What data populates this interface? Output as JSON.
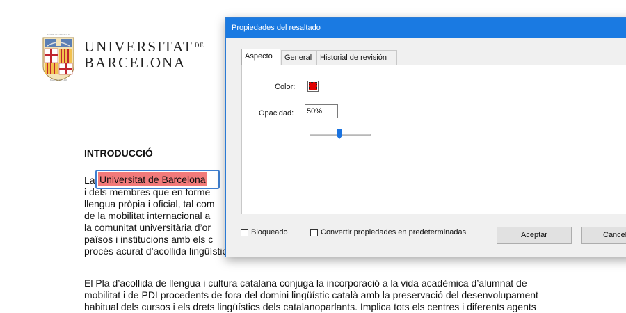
{
  "document": {
    "logo": {
      "line1": "UNIVERSITAT",
      "line1_suffix": "DE",
      "line2": "BARCELONA"
    },
    "heading": "INTRODUCCIÓ",
    "paragraph1": {
      "lines": [
        "La",
        "i dels membres que en forme",
        "llengua pròpia i oficial, tal com",
        "de la mobilitat internacional a",
        "la comunitat universitària d’or",
        "països i institucions amb els c",
        "procés acurat d’acollida lingüística i cultural, destinat a l’alumnat de grau i de postgrau, i també al PDI."
      ],
      "highlighted_text": "Universitat de Barcelona",
      "highlight_color": "#f27a7a"
    },
    "paragraph2": {
      "lines": [
        "El Pla d’acollida de llengua i cultura catalana conjuga la incorporació a la vida acadèmica d’alumnat de",
        "mobilitat i de PDI procedents de fora del domini lingüístic català amb la preservació del desenvolupament",
        "habitual dels cursos i els drets lingüístics dels catalanoparlants. Implica tots els centres i diferents agents"
      ]
    }
  },
  "dialog": {
    "title": "Propiedades del resaltado",
    "tabs": [
      {
        "label": "Aspecto",
        "active": true
      },
      {
        "label": "General",
        "active": false
      },
      {
        "label": "Historial de revisión",
        "active": false
      }
    ],
    "color_label": "Color:",
    "color_value": "#e00000",
    "opacity_label": "Opacidad:",
    "opacity_value": "50%",
    "opacity_slider_fraction": 0.5,
    "locked_label": "Bloqueado",
    "locked_checked": false,
    "defaults_label": "Convertir propiedades en predeterminadas",
    "defaults_checked": false,
    "ok_button": "Aceptar",
    "cancel_button": "Cancelar"
  },
  "colors": {
    "titlebar": "#1a7ae2",
    "focus_border": "#3f7fd0",
    "slider_thumb": "#1a73e0"
  }
}
